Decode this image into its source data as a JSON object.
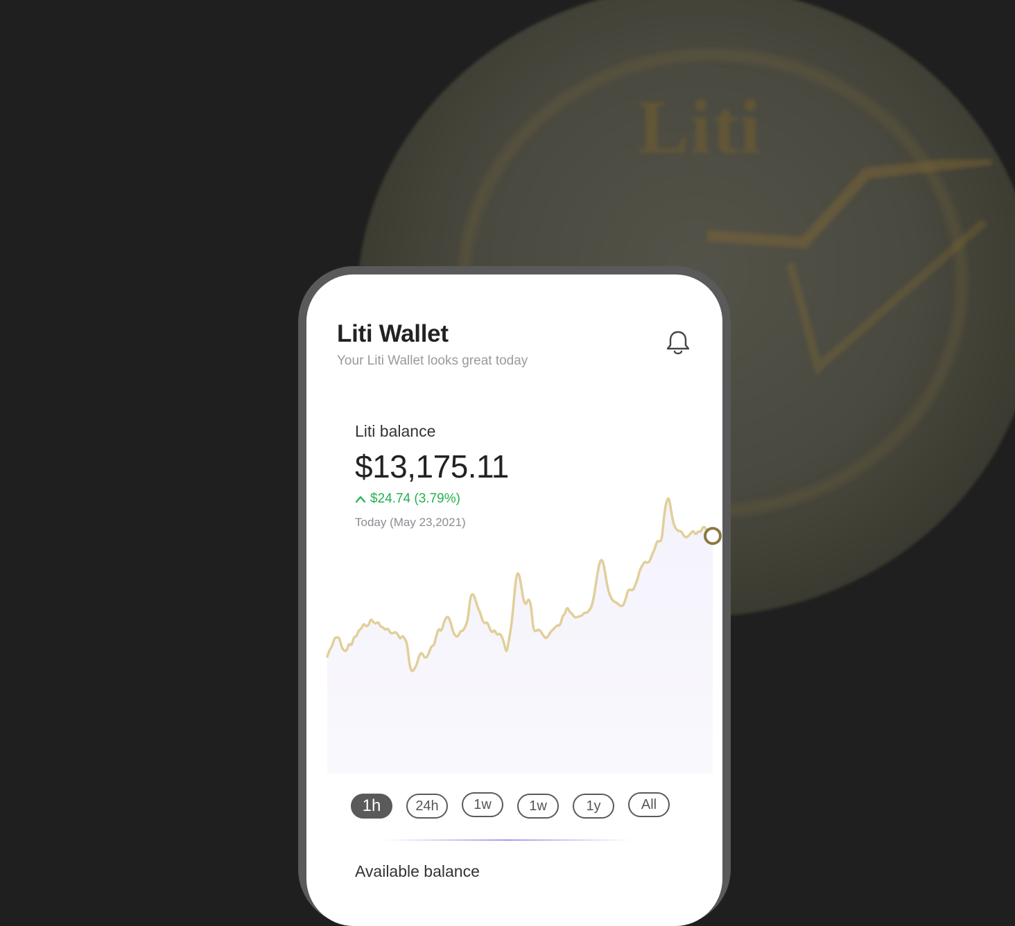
{
  "app": {
    "title": "Liti Wallet",
    "subtitle": "Your Liti Wallet looks great today",
    "notification_icon": "bell-icon"
  },
  "balance": {
    "label": "Liti balance",
    "value": "$13,175.11",
    "change": "$24.74 (3.79%)",
    "change_direction_icon": "chevron-up-icon",
    "date": "Today (May 23,2021)"
  },
  "chart_data": {
    "type": "line",
    "values": [
      28.8,
      31.9,
      33.4,
      37.1,
      37.4,
      37.3,
      32.8,
      31.4,
      31.3,
      34.9,
      33.4,
      37.8,
      37.6,
      40.5,
      41.1,
      43.6,
      42.2,
      42.6,
      45.7,
      44.1,
      43.4,
      44.3,
      42.1,
      41.9,
      40.6,
      41.5,
      39.3,
      39.1,
      39.8,
      39.0,
      36.5,
      38.2,
      36.8,
      34.5,
      24.6,
      21.9,
      23.4,
      25.5,
      29.6,
      30.7,
      28.5,
      28.3,
      30.6,
      33.6,
      33.6,
      38.1,
      41.5,
      39.8,
      43.5,
      46.2,
      46.6,
      43.7,
      39.4,
      37.8,
      37.8,
      40.3,
      40.2,
      42.3,
      45.1,
      55.4,
      57.0,
      54.6,
      50.8,
      48.6,
      44.9,
      43.4,
      44.3,
      41.4,
      39.3,
      40.9,
      38.3,
      39.2,
      37.9,
      34.6,
      30.0,
      36.7,
      42.8,
      54.1,
      65.2,
      66.1,
      60.5,
      53.5,
      51.8,
      54.7,
      52.3,
      40.8,
      39.9,
      41.0,
      40.2,
      38.4,
      36.9,
      37.6,
      39.7,
      40.7,
      41.8,
      42.9,
      42.4,
      46.6,
      47.8,
      51.0,
      48.6,
      47.9,
      46.2,
      46.3,
      46.7,
      47.0,
      48.3,
      48.2,
      49.2,
      50.9,
      55.4,
      62.6,
      69.1,
      72.3,
      70.3,
      63.4,
      57.8,
      55.0,
      53.4,
      53.0,
      52.2,
      51.2,
      51.4,
      53.9,
      58.4,
      58.6,
      58.1,
      60.4,
      63.2,
      67.5,
      69.3,
      71.1,
      70.4,
      71.0,
      74.2,
      76.3,
      80.2,
      79.9,
      80.4,
      92.2,
      98.2,
      99.6,
      92.2,
      87.2,
      85.3,
      84.5,
      84.5,
      82.6,
      81.6,
      82.4,
      83.7,
      84.8,
      82.8,
      84.6,
      84.0,
      86.5,
      86.2,
      82.9,
      82.2,
      82.4
    ],
    "ylim": [
      0,
      100
    ],
    "series_color": "#e1cf9a",
    "fill_color": "#f4f2fb",
    "marker_color": "#8a7a45",
    "grid": false
  },
  "time_ranges": {
    "selected": "1h",
    "items": [
      {
        "label": "1h"
      },
      {
        "label": "24h"
      },
      {
        "label": "1w"
      },
      {
        "label": "1w"
      },
      {
        "label": "1y"
      },
      {
        "label": "All"
      }
    ]
  },
  "available": {
    "label": "Available balance"
  },
  "colors": {
    "accent_gold": "#e1cf9a",
    "positive": "#22b24c",
    "phone_frame": "#5a5a5a",
    "background": "#1f1f1f"
  },
  "background_image": {
    "coin_text": "Liti"
  }
}
